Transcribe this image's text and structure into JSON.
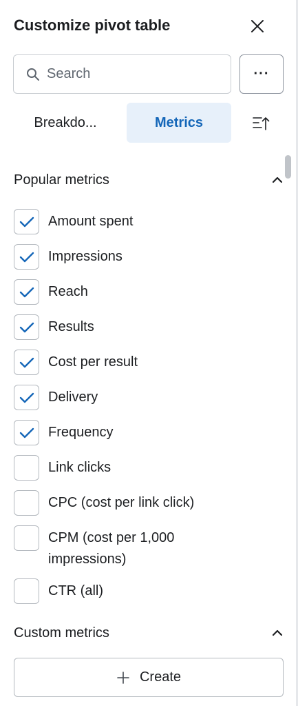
{
  "header": {
    "title": "Customize pivot table"
  },
  "search": {
    "placeholder": "Search"
  },
  "more_button": {
    "label": "···"
  },
  "tabs": [
    {
      "label": "Breakdo...",
      "selected": false
    },
    {
      "label": "Metrics",
      "selected": true
    }
  ],
  "sections": {
    "popular": {
      "title": "Popular metrics",
      "items": [
        {
          "label": "Amount spent",
          "checked": true
        },
        {
          "label": "Impressions",
          "checked": true
        },
        {
          "label": "Reach",
          "checked": true
        },
        {
          "label": "Results",
          "checked": true
        },
        {
          "label": "Cost per result",
          "checked": true
        },
        {
          "label": "Delivery",
          "checked": true
        },
        {
          "label": "Frequency",
          "checked": true
        },
        {
          "label": "Link clicks",
          "checked": false
        },
        {
          "label": "CPC (cost per link click)",
          "checked": false
        },
        {
          "label": "CPM (cost per 1,000 impressions)",
          "checked": false
        },
        {
          "label": "CTR (all)",
          "checked": false
        }
      ]
    },
    "custom": {
      "title": "Custom metrics"
    }
  },
  "create_button": {
    "label": "Create"
  },
  "colors": {
    "accent": "#1466b8",
    "tab_selected_bg": "#e7f0fa",
    "border": "#b3b8be"
  }
}
